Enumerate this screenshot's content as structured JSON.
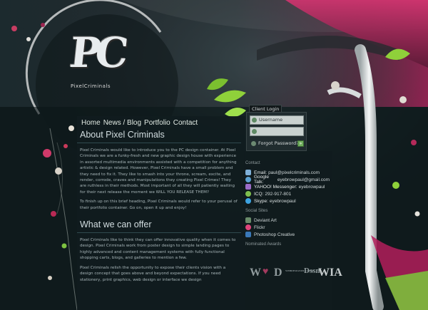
{
  "logo": {
    "text": "PC",
    "tagline": "PixelCriminals"
  },
  "nav": {
    "items": [
      {
        "label": "Home"
      },
      {
        "label": "News / Blog"
      },
      {
        "label": "Portfolio"
      },
      {
        "label": "Contact"
      }
    ]
  },
  "main": {
    "about_title": "About Pixel Criminals",
    "about_paragraphs": [
      "Pixel Criminals would like to introduce you to the PC design container. At Pixel Criminals we are a funky-fresh and new graphic design house with experience in assorted multimedia environments assisted with a competition for anything artistic & design related. However, Pixel Criminals have a small problem and they need to fix it. They like to smash into your throne, scream, excite, and render, corrode, craves and manipulations they creating Pixel Crimes! They are ruthless in their methods. Most important of all they will patiently waiting for their next release the moment we WILL YOU RELEASE THEM?",
      "To finish up on this brief heading, Pixel Criminals would refer to your perusal of their portfolio container. Go on, open it up and enjoy!"
    ],
    "offer_title": "What we can offer",
    "offer_paragraphs": [
      "Pixel Criminals like to think they can offer innovative quality when it comes to design. Pixel Criminals work from poster design to simple landing pages to highly advanced and content management systems with fully functional shopping carts, blogs, and galleries to mention a few.",
      "Pixel Criminals relish the opportunity to expose their clients vision with a design concept that goes above and beyond expectations. If you need stationery, print graphics, web design or interface we design"
    ]
  },
  "login": {
    "label": "Client Login",
    "username_value": "Username",
    "password_value": "",
    "forgot_label": "Forgot Password?",
    "submit_label": "»"
  },
  "contact": {
    "heading": "Contact",
    "rows": [
      {
        "icon": "email-icon",
        "label": "Email:",
        "value": "paul@pixelcriminals.com",
        "color": "#7fb0d8"
      },
      {
        "icon": "google-talk-icon",
        "label": "Google Talk:",
        "value": "eyebrowpaul@gmail.com",
        "color": "#5ba0d0"
      },
      {
        "icon": "yahoo-icon",
        "label": "YAHOO! Messenger:",
        "value": "eyebrowpaul",
        "color": "#9b6cc8"
      },
      {
        "icon": "icq-icon",
        "label": "ICQ:",
        "value": "292-917-801",
        "color": "#7fbf4d"
      },
      {
        "icon": "skype-icon",
        "label": "Skype:",
        "value": "eyebrowpaul",
        "color": "#3da3e0"
      }
    ]
  },
  "social": {
    "heading": "Social Sites",
    "items": [
      {
        "icon": "deviantart-icon",
        "label": "Deviant Art",
        "color": "#6a8b6a"
      },
      {
        "icon": "flickr-icon",
        "label": "Flickr",
        "color": "#e0457b"
      },
      {
        "icon": "photoshop-icon",
        "label": "Photoshop Creative",
        "color": "#3a78b8"
      }
    ]
  },
  "awards": {
    "heading": "Nominated Awards",
    "items": [
      "W",
      "♥",
      "D",
      "WEBDESIGNFILE.COM",
      "Dssn",
      "WIA"
    ]
  },
  "colors": {
    "accent_green": "#8fd13a",
    "accent_magenta": "#c0336e",
    "background": "#0f1a1d"
  }
}
